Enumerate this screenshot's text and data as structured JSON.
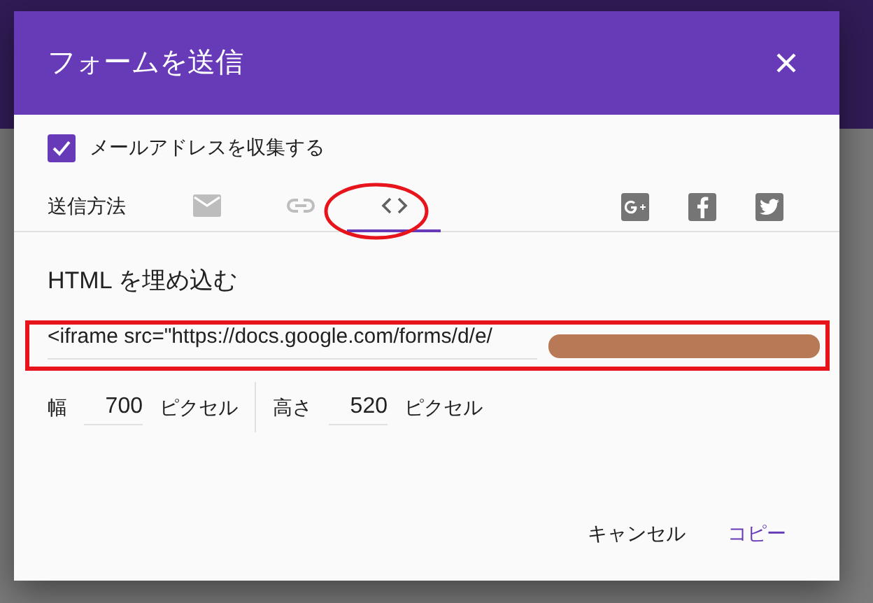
{
  "dialog": {
    "title": "フォームを送信",
    "collect_email": {
      "label": "メールアドレスを収集する",
      "checked": true
    },
    "send_via": {
      "label": "送信方法",
      "tabs": [
        {
          "kind": "email",
          "selected": false
        },
        {
          "kind": "link",
          "selected": false
        },
        {
          "kind": "embed",
          "selected": true
        }
      ],
      "share": [
        {
          "kind": "googleplus"
        },
        {
          "kind": "facebook"
        },
        {
          "kind": "twitter"
        }
      ]
    },
    "embed": {
      "heading": "HTML を埋め込む",
      "code": "<iframe src=\"https://docs.google.com/forms/d/e/",
      "width": {
        "label": "幅",
        "value": "700",
        "unit": "ピクセル"
      },
      "height": {
        "label": "高さ",
        "value": "520",
        "unit": "ピクセル"
      }
    },
    "buttons": [
      {
        "label": "キャンセル",
        "kind": "cancel"
      },
      {
        "label": "コピー",
        "kind": "primary"
      }
    ]
  }
}
